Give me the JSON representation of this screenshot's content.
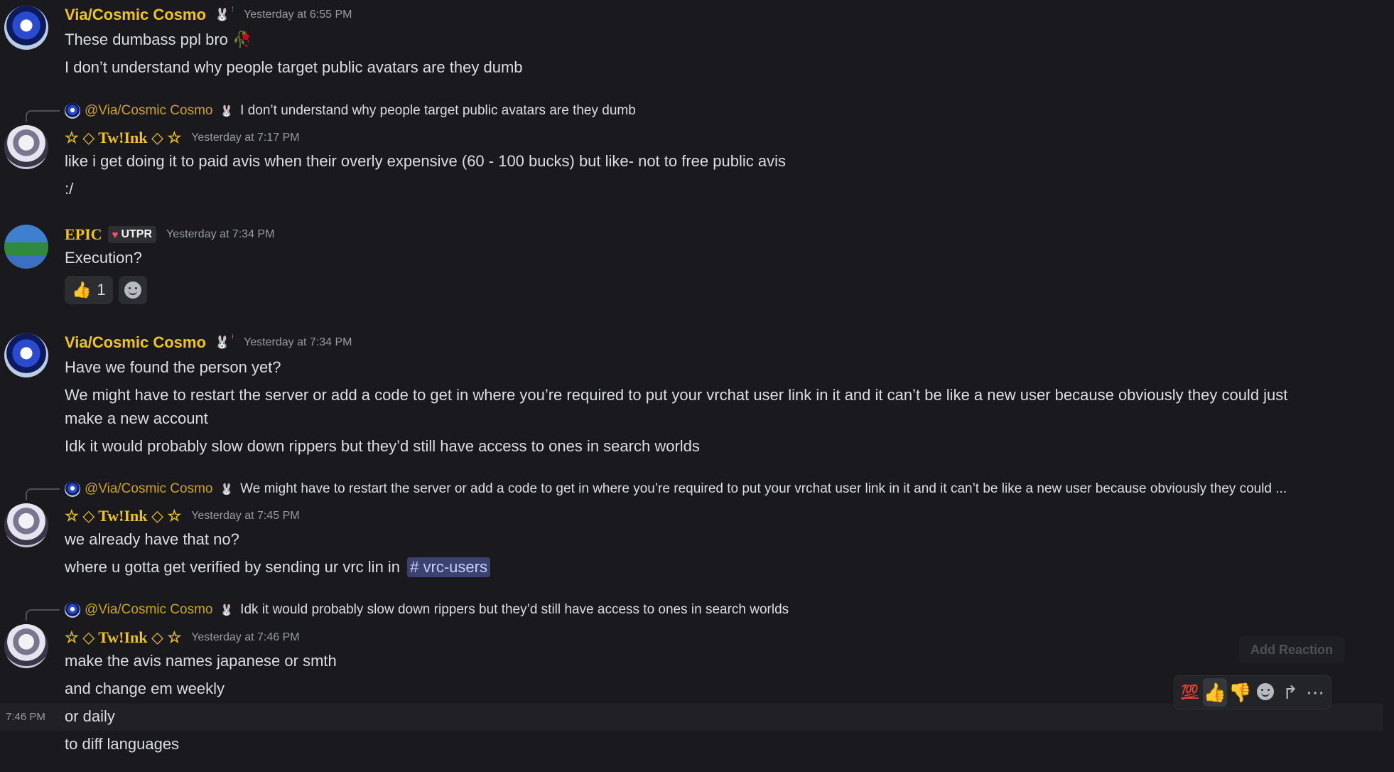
{
  "messages": [
    {
      "author": "Via/Cosmic Cosmo",
      "tag": "🐰",
      "timestamp": "Yesterday at 6:55 PM",
      "lines": [
        "These dumbass ppl bro 🥀",
        "I don’t understand why people target public avatars are they dumb"
      ]
    },
    {
      "reply_to": "@Via/Cosmic Cosmo",
      "reply_tag": "🐰",
      "reply_text": "I don’t understand why people target public avatars are they dumb",
      "author": "☆ ◇ Tw!Ink ◇ ☆",
      "timestamp": "Yesterday at 7:17 PM",
      "lines": [
        "like i get doing it to paid avis when their overly expensive (60 - 100 bucks) but like- not to free public avis",
        ":/"
      ]
    },
    {
      "author": "EPIC",
      "badge": "UTPR",
      "timestamp": "Yesterday at 7:34 PM",
      "lines": [
        "Execution?"
      ],
      "reactions": [
        {
          "emoji": "👍",
          "count": "1"
        }
      ]
    },
    {
      "author": "Via/Cosmic Cosmo",
      "tag": "🐰",
      "timestamp": "Yesterday at 7:34 PM",
      "lines": [
        "Have we found the person yet?",
        "We might have to restart the server or add a code to get in where you’re required to put your vrchat user link in it and it can’t be like a new user because obviously they could just",
        "make a new account",
        "Idk it would probably slow down rippers but they’d still have access to ones in search worlds"
      ]
    },
    {
      "reply_to": "@Via/Cosmic Cosmo",
      "reply_tag": "🐰",
      "reply_text": "We might have to restart the server or add a code to get in where you’re required to put your vrchat user link in it and it can’t be like a new user because obviously they could ...",
      "author": "☆ ◇ Tw!Ink ◇ ☆",
      "timestamp": "Yesterday at 7:45 PM",
      "lines": [
        "we already have that no?",
        "where u gotta get verified by sending ur vrc lin in"
      ],
      "channel": "# vrc-users"
    },
    {
      "reply_to": "@Via/Cosmic Cosmo",
      "reply_tag": "🐰",
      "reply_text": "Idk it would probably slow down rippers but they’d still have access to ones in search worlds",
      "author": "☆ ◇ Tw!Ink ◇ ☆",
      "timestamp": "Yesterday at 7:46 PM",
      "lines": [
        "make the avis names japanese or smth",
        "and change em weekly",
        "or daily",
        "to diff languages"
      ],
      "hover_time": "7:46 PM"
    }
  ],
  "toolbar": {
    "tooltip": "Add Reaction",
    "buttons": [
      "💯",
      "👍",
      "👎",
      "add-reaction-icon",
      "forward-icon",
      "more-icon"
    ]
  },
  "colors": {
    "username": "#f0c419",
    "background": "#1a1a1e",
    "mention": "#c9a227"
  }
}
